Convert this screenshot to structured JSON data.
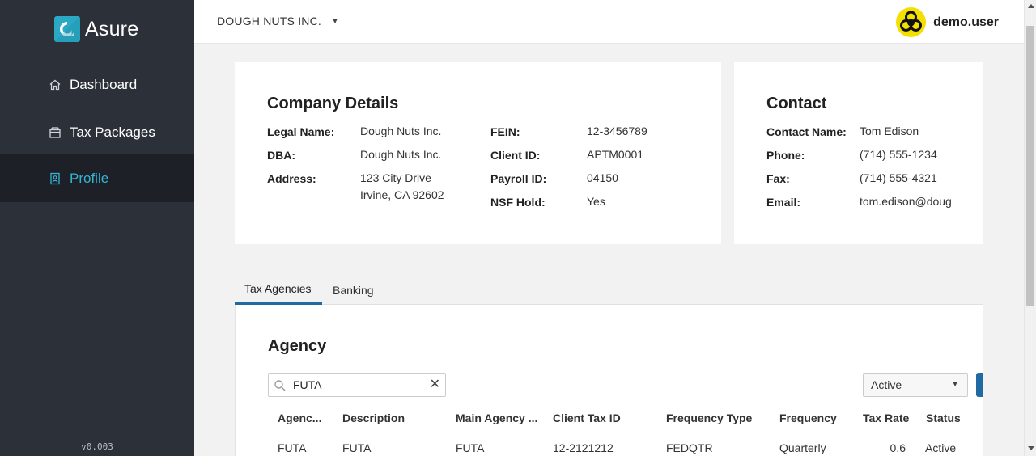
{
  "app": {
    "logo_text": "Asure",
    "version": "v0.003"
  },
  "sidebar": {
    "items": [
      {
        "label": "Dashboard",
        "icon": "home-icon"
      },
      {
        "label": "Tax Packages",
        "icon": "package-icon"
      },
      {
        "label": "Profile",
        "icon": "profile-icon",
        "active": true
      }
    ]
  },
  "header": {
    "company": "DOUGH NUTS INC.",
    "username": "demo.user",
    "avatar_icon": "biohazard-icon"
  },
  "company_details": {
    "title": "Company Details",
    "fields": [
      {
        "label": "Legal Name:",
        "value": "Dough Nuts Inc."
      },
      {
        "label": "DBA:",
        "value": "Dough Nuts Inc."
      },
      {
        "label": "Address:",
        "value": "123 City Drive",
        "value2": "Irvine, CA 92602"
      },
      {
        "label": "FEIN:",
        "value": "12-3456789"
      },
      {
        "label": "Client ID:",
        "value": "APTM0001"
      },
      {
        "label": "Payroll ID:",
        "value": "04150"
      },
      {
        "label": "NSF Hold:",
        "value": "Yes"
      }
    ]
  },
  "contact": {
    "title": "Contact",
    "fields": [
      {
        "label": "Contact Name:",
        "value": "Tom Edison"
      },
      {
        "label": "Phone:",
        "value": "(714) 555-1234"
      },
      {
        "label": "Fax:",
        "value": "(714) 555-4321"
      },
      {
        "label": "Email:",
        "value": "tom.edison@doug"
      }
    ]
  },
  "tabs": [
    {
      "label": "Tax Agencies",
      "active": true
    },
    {
      "label": "Banking"
    }
  ],
  "agency": {
    "title": "Agency",
    "search_value": "FUTA",
    "status_filter": "Active",
    "columns": [
      "Agenc...",
      "Description",
      "Main Agency ...",
      "Client Tax ID",
      "Frequency Type",
      "Frequency",
      "Tax Rate",
      "Status"
    ],
    "rows": [
      [
        "FUTA",
        "FUTA",
        "FUTA",
        "12-2121212",
        "FEDQTR",
        "Quarterly",
        "0.6",
        "Active"
      ]
    ]
  },
  "colors": {
    "sidebar_bg": "#2c3038",
    "active_nav_bg": "#1d2127",
    "accent": "#35b3d1",
    "primary_button": "#1e6aa1"
  }
}
